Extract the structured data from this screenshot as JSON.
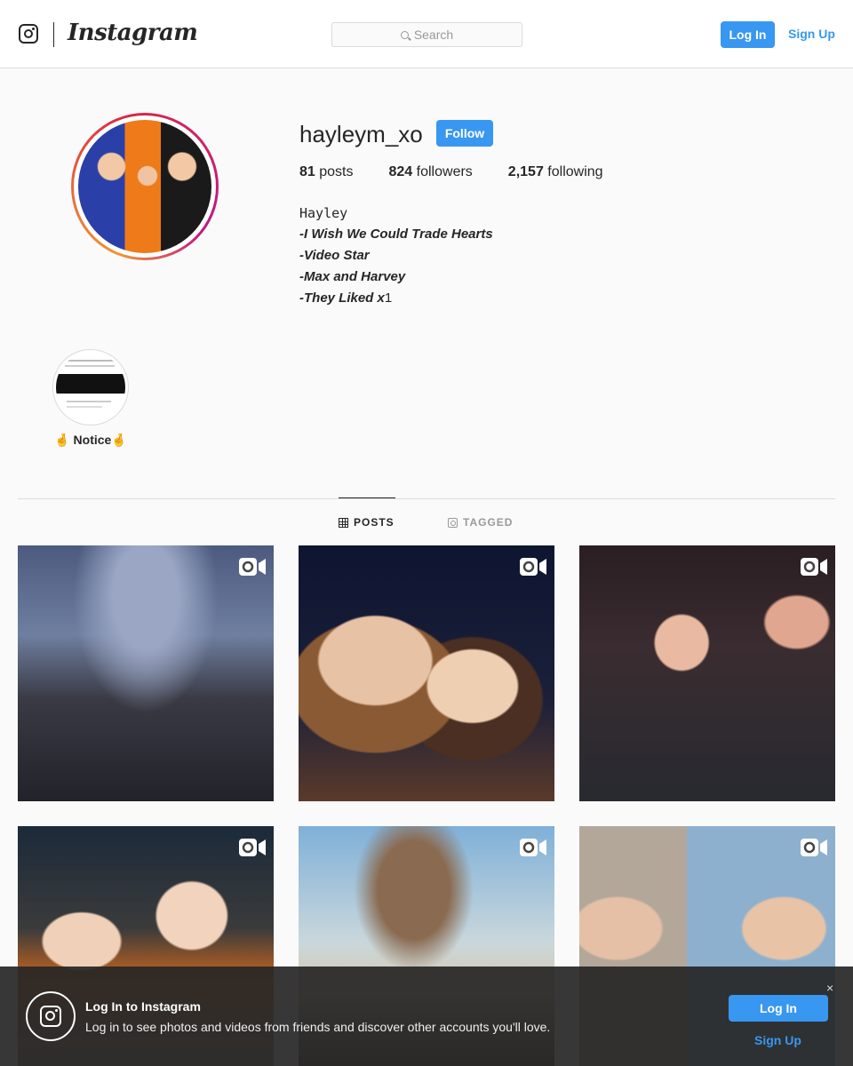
{
  "nav": {
    "wordmark": "Instagram",
    "search_placeholder": "Search",
    "login_label": "Log In",
    "signup_label": "Sign Up"
  },
  "profile": {
    "username": "hayleym_xo",
    "follow_label": "Follow",
    "stats": {
      "posts_count": "81",
      "posts_label": "posts",
      "followers_count": "824",
      "followers_label": "followers",
      "following_count": "2,157",
      "following_label": "following"
    },
    "bio": {
      "name": "Hayley",
      "lines": [
        "-I Wish We Could Trade Hearts",
        "-Video Star",
        "-Max and Harvey",
        "-They Liked x"
      ],
      "line4_suffix": "1"
    }
  },
  "highlights": [
    {
      "label": "🤞 Notice🤞",
      "image_text": "Holy friggle I was a shook"
    }
  ],
  "tabs": {
    "posts": "POSTS",
    "tagged": "TAGGED",
    "active": "posts"
  },
  "posts": [
    {
      "type": "video"
    },
    {
      "type": "video"
    },
    {
      "type": "video"
    },
    {
      "type": "video"
    },
    {
      "type": "video"
    },
    {
      "type": "video"
    }
  ],
  "banner": {
    "title": "Log In to Instagram",
    "text": "Log in to see photos and videos from friends and discover other accounts you'll love.",
    "login_label": "Log In",
    "signup_label": "Sign Up",
    "close_glyph": "×"
  },
  "colors": {
    "accent": "#3897f0",
    "text": "#262626",
    "border": "#dbdbdb",
    "background": "#fafafa"
  }
}
